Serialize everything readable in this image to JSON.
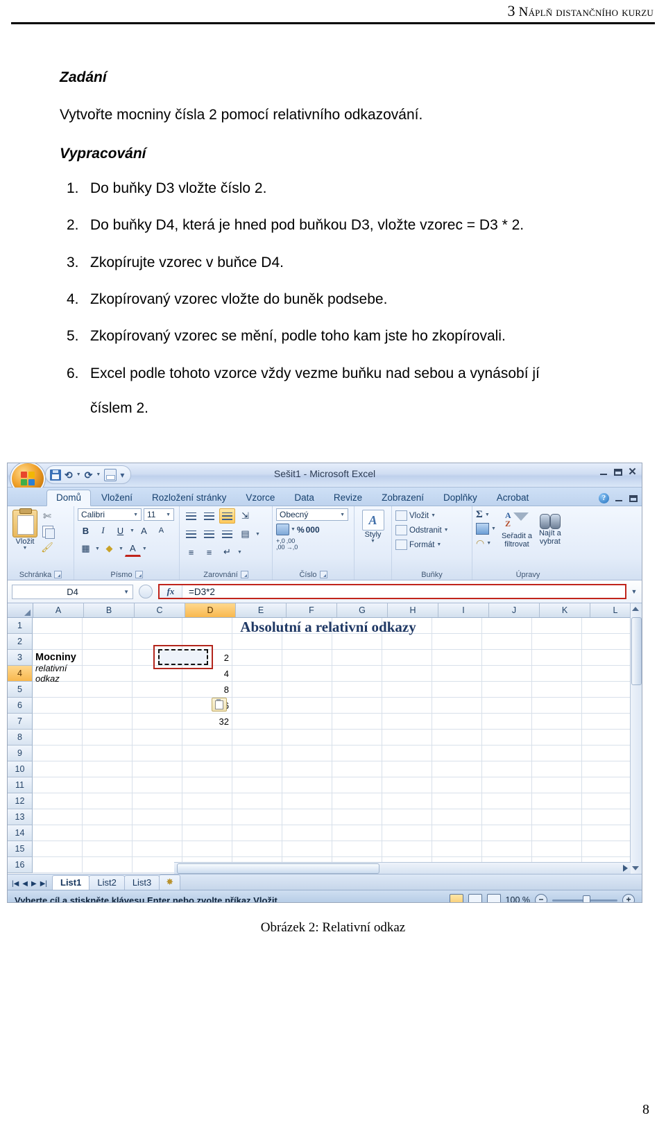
{
  "page": {
    "running_header": "3 Náplň distančního kurzu",
    "running_header_lead": "3",
    "running_header_rest": "Náplň distančního kurzu",
    "page_number": "8",
    "figure_caption": "Obrázek 2: Relativní odkaz"
  },
  "document": {
    "heading_zadani": "Zadání",
    "assignment_text": "Vytvořte mocniny čísla 2 pomocí relativního odkazování.",
    "heading_vypracovani": "Vypracování",
    "steps": [
      {
        "num": "1.",
        "text": "Do buňky D3 vložte číslo 2."
      },
      {
        "num": "2.",
        "text": "Do buňky D4, která je hned pod buňkou D3, vložte vzorec = D3 * 2."
      },
      {
        "num": "3.",
        "text": "Zkopírujte vzorec v buňce D4."
      },
      {
        "num": "4.",
        "text": "Zkopírovaný vzorec vložte do buněk podsebe."
      },
      {
        "num": "5.",
        "text": "Zkopírovaný vzorec se mění, podle toho kam jste ho zkopírovali."
      },
      {
        "num": "6.",
        "text": "Excel podle tohoto vzorce vždy vezme buňku nad sebou a vynásobí jí",
        "continuation": "číslem 2."
      }
    ]
  },
  "excel": {
    "title_bar": {
      "document_title": "Sešit1 - Microsoft Excel",
      "quick_access": [
        "save-icon",
        "undo-icon",
        "redo-icon",
        "print-preview-icon",
        "customize-qat-icon"
      ],
      "window_buttons": [
        "minimize",
        "maximize",
        "close"
      ],
      "close_glyph": "✕"
    },
    "tabs": [
      {
        "label": "Domů",
        "active": true
      },
      {
        "label": "Vložení",
        "active": false
      },
      {
        "label": "Rozložení stránky",
        "active": false
      },
      {
        "label": "Vzorce",
        "active": false
      },
      {
        "label": "Data",
        "active": false
      },
      {
        "label": "Revize",
        "active": false
      },
      {
        "label": "Zobrazení",
        "active": false
      },
      {
        "label": "Doplňky",
        "active": false
      },
      {
        "label": "Acrobat",
        "active": false
      }
    ],
    "help_icon_label": "?",
    "ribbon": {
      "clipboard": {
        "group_label": "Schránka",
        "paste_label": "Vložit",
        "cut_icon": "scissors-icon",
        "copy_icon": "copy-icon",
        "format_painter_icon": "format-painter-icon"
      },
      "font": {
        "group_label": "Písmo",
        "font_name": "Calibri",
        "font_size": "11",
        "bold": "B",
        "italic": "I",
        "underline": "U",
        "grow_font": "A",
        "shrink_font": "A",
        "borders_icon": "borders-icon",
        "fill_color_icon": "fill-color-icon",
        "font_color": "A"
      },
      "alignment": {
        "group_label": "Zarovnání",
        "align_top": "align-top-icon",
        "align_middle": "align-middle-icon",
        "align_bottom": "align-bottom-icon",
        "orientation": "orientation-icon",
        "align_left": "align-left-icon",
        "align_center": "align-center-icon",
        "align_right": "align-right-icon",
        "merge_cells": "merge-cells-icon",
        "decrease_indent": "decrease-indent-icon",
        "increase_indent": "increase-indent-icon",
        "wrap_text": "wrap-text-icon"
      },
      "number": {
        "group_label": "Číslo",
        "format": "Obecný",
        "currency_icon": "currency-icon",
        "percent": "%",
        "comma": "000",
        "increase_decimal": "+,0",
        "decrease_decimal": ",00"
      },
      "styles": {
        "group_label": "Styly",
        "label": "Styly"
      },
      "cells": {
        "group_label": "Buňky",
        "insert": "Vložit",
        "delete": "Odstranit",
        "format": "Formát"
      },
      "editing": {
        "group_label": "Úpravy",
        "autosum": "Σ",
        "fill_icon": "fill-down-icon",
        "clear_icon": "eraser-icon",
        "sort_filter_line1": "Seřadit a",
        "sort_filter_line2": "filtrovat",
        "find_select_line1": "Najít a",
        "find_select_line2": "vybrat"
      }
    },
    "formula_bar": {
      "name_box": "D4",
      "fx_label": "fx",
      "formula": "=D3*2"
    },
    "grid": {
      "columns": [
        "A",
        "B",
        "C",
        "D",
        "E",
        "F",
        "G",
        "H",
        "I",
        "J",
        "K",
        "L"
      ],
      "selected_column": "D",
      "rows": [
        "1",
        "2",
        "3",
        "4",
        "5",
        "6",
        "7",
        "8",
        "9",
        "10",
        "11",
        "12",
        "13",
        "14",
        "15",
        "16"
      ],
      "selected_row": "4",
      "sheet_title": "Absolutní a relativní odkazy",
      "cell_a3": "Mocniny",
      "cell_a4": "relativní odkaz",
      "column_d_values": [
        {
          "row": "3",
          "value": "2"
        },
        {
          "row": "4",
          "value": "4"
        },
        {
          "row": "5",
          "value": "8"
        },
        {
          "row": "6",
          "value": "16"
        },
        {
          "row": "7",
          "value": "32"
        }
      ],
      "paste_options_icon": "paste-options-icon",
      "copied_cell": "D4"
    },
    "sheet_tabs": [
      {
        "label": "List1",
        "active": true
      },
      {
        "label": "List2",
        "active": false
      },
      {
        "label": "List3",
        "active": false
      }
    ],
    "new_sheet_icon": "insert-worksheet-icon",
    "status_bar": {
      "message": "Vyberte cíl a stiskněte klávesu Enter nebo zvolte příkaz Vložit.",
      "zoom_level": "100 %",
      "view_normal": "normal-view-icon",
      "view_layout": "page-layout-view-icon",
      "view_break": "page-break-view-icon",
      "zoom_out": "−",
      "zoom_in": "+"
    }
  },
  "colors": {
    "accent_orange": "#f8b84e",
    "red_highlight": "#b3251c",
    "sheet_title_navy": "#1f3864",
    "ribbon_blue": "#16406e"
  }
}
